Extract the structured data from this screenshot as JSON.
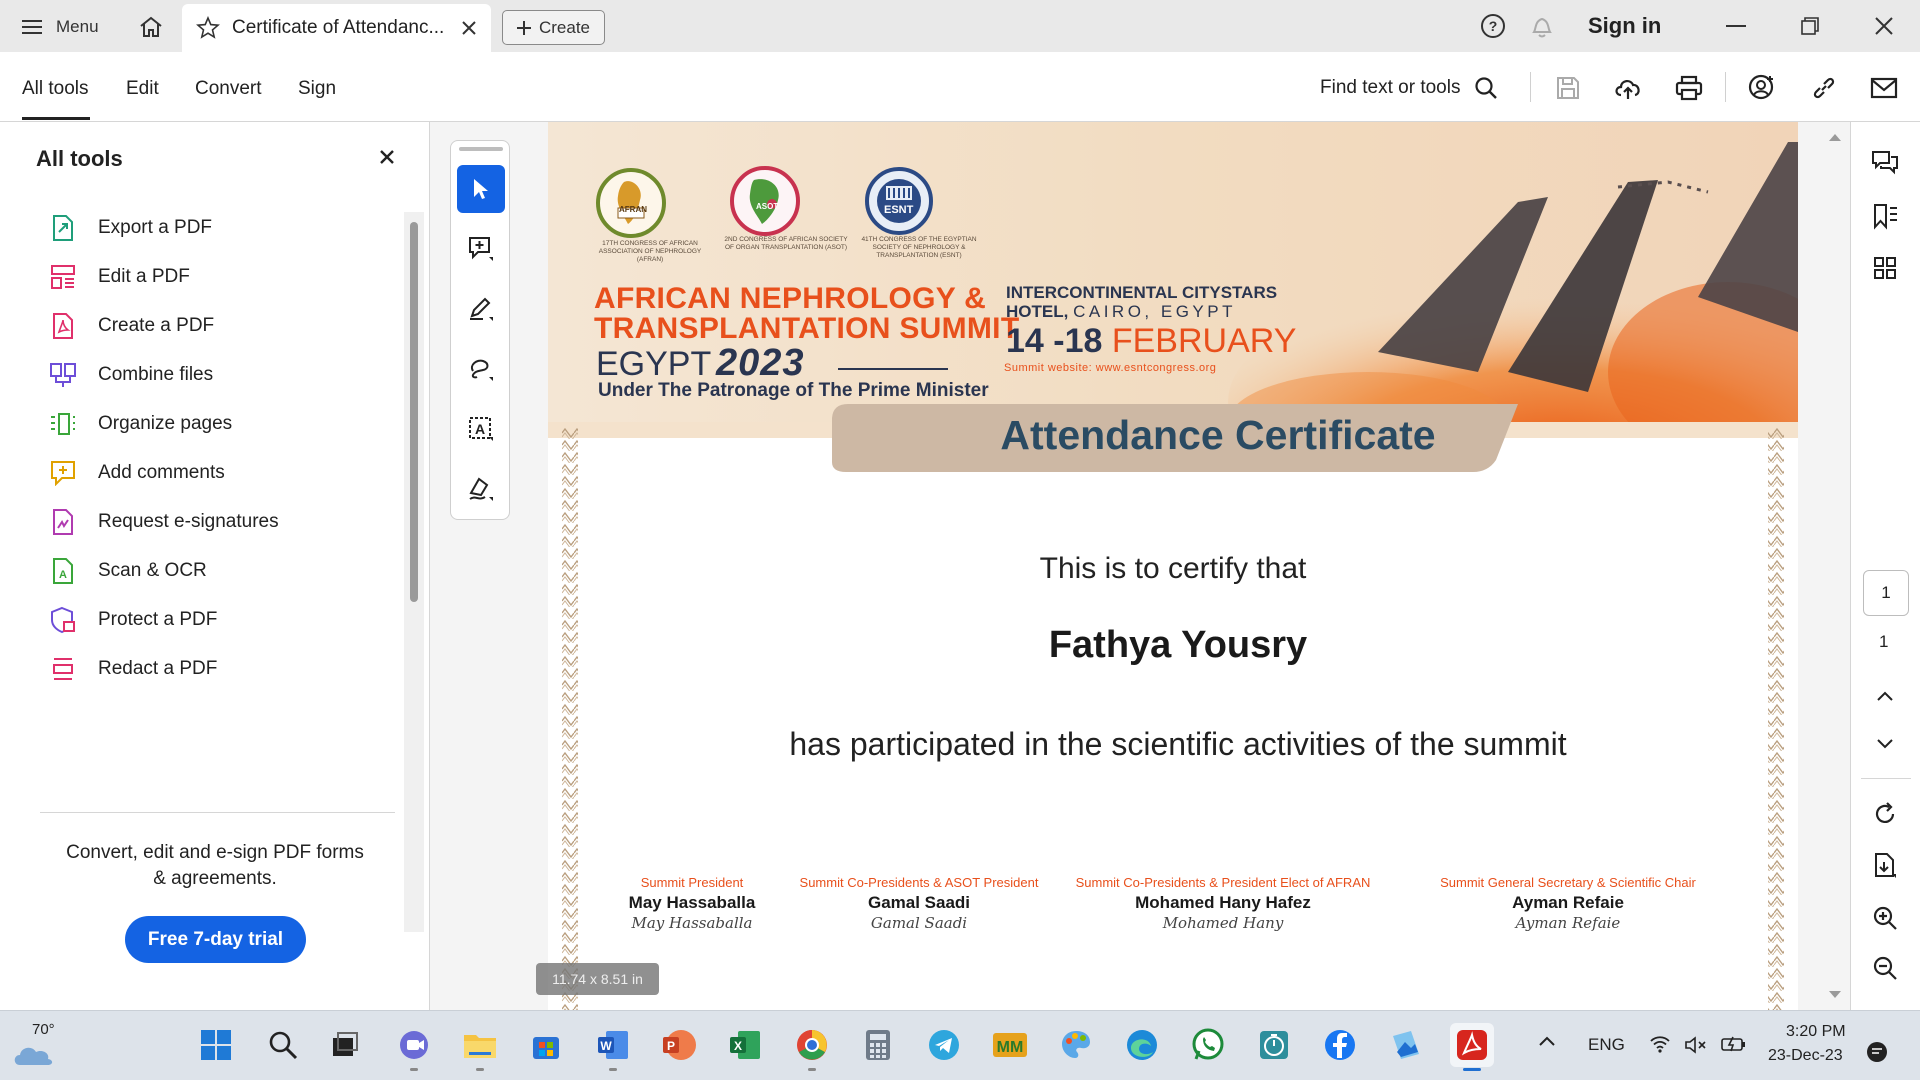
{
  "titlebar": {
    "menu_label": "Menu",
    "tab_title": "Certificate of Attendanc...",
    "create_label": "Create",
    "signin_label": "Sign in"
  },
  "toolbar": {
    "tabs": [
      "All tools",
      "Edit",
      "Convert",
      "Sign"
    ],
    "find_label": "Find text or tools"
  },
  "panel": {
    "title": "All tools",
    "items": [
      {
        "label": "Export a PDF",
        "icon": "export-pdf-icon",
        "color": "#1f9e7a"
      },
      {
        "label": "Edit a PDF",
        "icon": "edit-pdf-icon",
        "color": "#e0306b"
      },
      {
        "label": "Create a PDF",
        "icon": "create-pdf-icon",
        "color": "#e0306b"
      },
      {
        "label": "Combine files",
        "icon": "combine-files-icon",
        "color": "#6d4ed8"
      },
      {
        "label": "Organize pages",
        "icon": "organize-pages-icon",
        "color": "#3aa63a"
      },
      {
        "label": "Add comments",
        "icon": "add-comments-icon",
        "color": "#e0a100"
      },
      {
        "label": "Request e-signatures",
        "icon": "request-esign-icon",
        "color": "#b03bb0"
      },
      {
        "label": "Scan & OCR",
        "icon": "scan-ocr-icon",
        "color": "#3aa63a"
      },
      {
        "label": "Protect a PDF",
        "icon": "protect-pdf-icon",
        "color": "#6d4ed8"
      },
      {
        "label": "Redact a PDF",
        "icon": "redact-pdf-icon",
        "color": "#e0306b"
      }
    ],
    "promo": "Convert, edit and e-sign PDF forms & agreements.",
    "trial_label": "Free 7-day trial"
  },
  "certificate": {
    "logo1_caption": "17TH CONGRESS OF AFRICAN ASSOCIATION OF NEPHROLOGY (AFRAN)",
    "logo1_text": "AFRAN",
    "logo2_caption": "2ND CONGRESS OF AFRICAN SOCIETY OF ORGAN TRANSPLANTATION (ASOT)",
    "logo2_text": "ASOT",
    "logo3_caption": "41TH CONGRESS OF THE EGYPTIAN SOCIETY OF NEPHROLOGY & TRANSPLANTATION (ESNT)",
    "logo3_text": "ESNT",
    "summit_line1": "AFRICAN NEPHROLOGY &",
    "summit_line2": "TRANSPLANTATION SUMMIT",
    "egypt_label": "EGYPT",
    "year_label": "2023",
    "patronage": "Under The Patronage of The Prime Minister",
    "venue_line1": "INTERCONTINENTAL CITYSTARS",
    "venue_line2_a": "HOTEL,",
    "venue_line2_b": "CAIRO, EGYPT",
    "dates_num": "14 -18",
    "dates_month": "FEBRUARY",
    "website": "Summit website: www.esntcongress.org",
    "cert_title": "Attendance Certificate",
    "certify_line": "This is to certify that",
    "recipient": "Fathya Yousry",
    "participation": "has participated in the scientific activities of the summit",
    "signatories": [
      {
        "role": "Summit President",
        "name": "May Hassaballa",
        "signature": "May Hassaballa"
      },
      {
        "role": "Summit Co-Presidents & ASOT President",
        "name": "Gamal Saadi",
        "signature": "Gamal Saadi"
      },
      {
        "role": "Summit Co-Presidents & President Elect of AFRAN",
        "name": "Mohamed Hany Hafez",
        "signature": "Mohamed Hany"
      },
      {
        "role": "Summit General Secretary & Scientific Chair",
        "name": "Ayman Refaie",
        "signature": "Ayman Refaie"
      }
    ]
  },
  "doc_dims": "11.74 x 8.51 in",
  "pager": {
    "current": "1",
    "total": "1"
  },
  "taskbar": {
    "weather": "70°",
    "lang": "ENG",
    "time": "3:20 PM",
    "date": "23-Dec-23"
  },
  "colors": {
    "accent": "#1463e3",
    "summit_orange": "#e8501c",
    "cert_title": "#2a4b63",
    "role_orange": "#e8501c"
  }
}
